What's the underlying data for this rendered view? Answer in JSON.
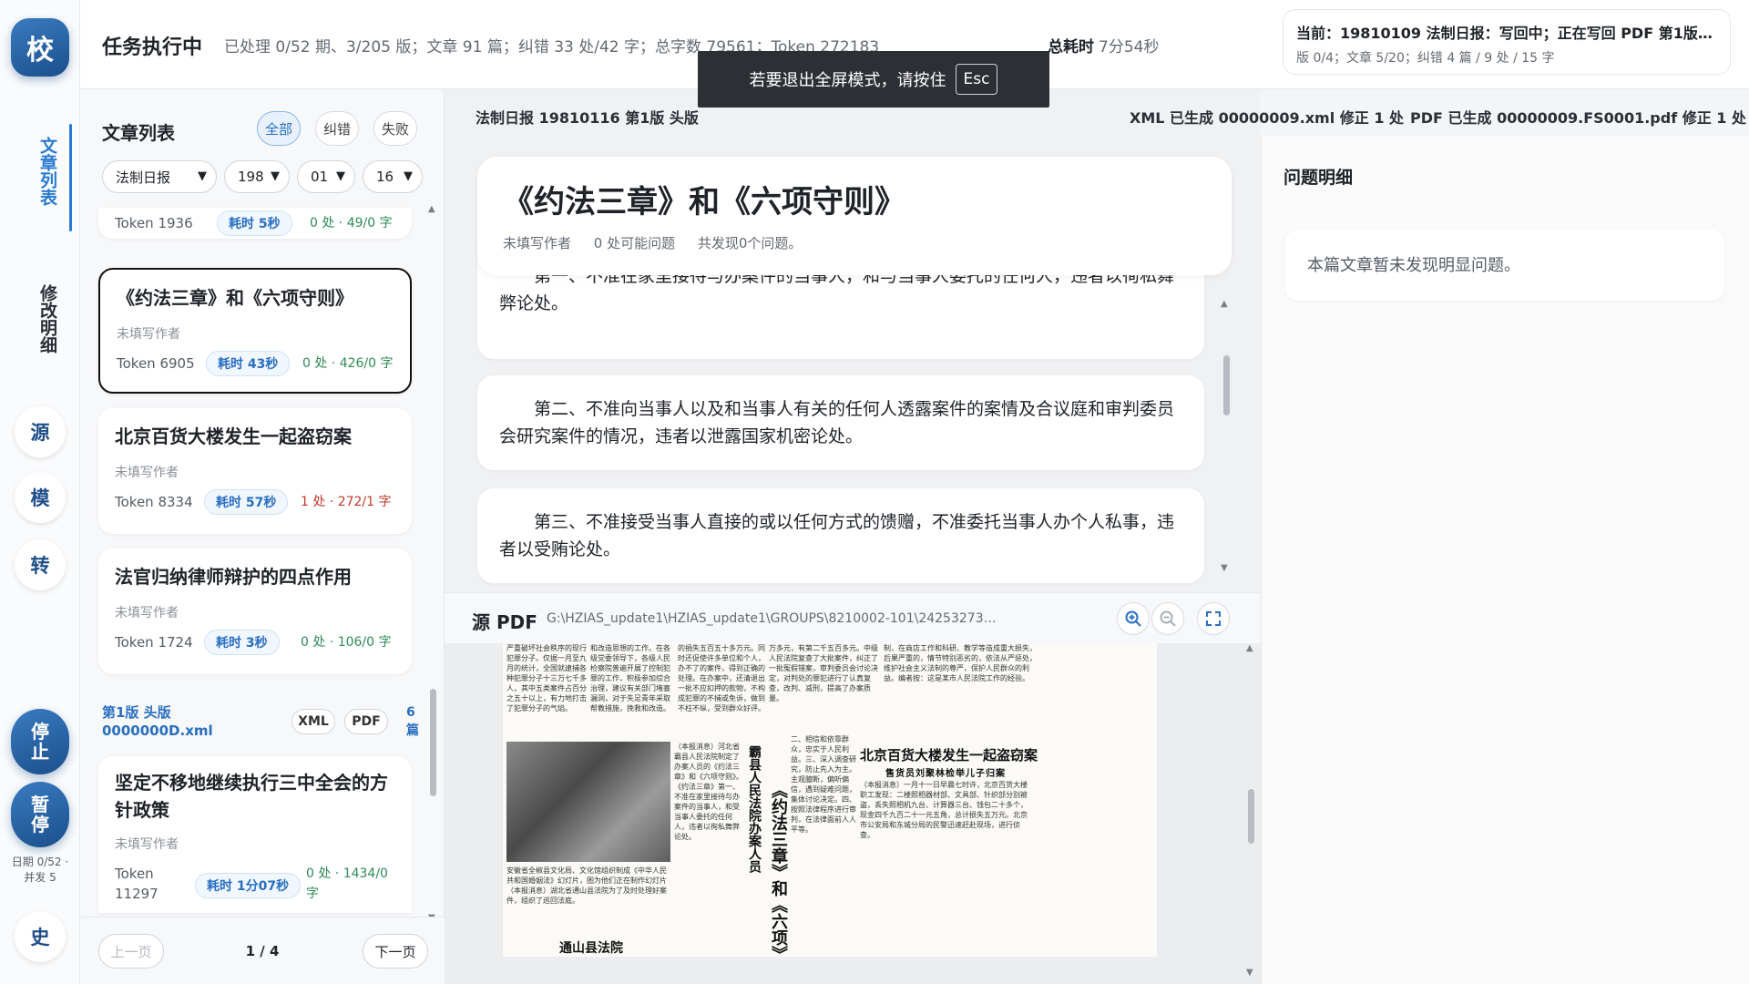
{
  "rail": {
    "logo": "校",
    "tab_articles": "文章列表",
    "tab_changes": "修改明细",
    "btn_source": "源",
    "btn_model": "模",
    "btn_convert": "转",
    "btn_stop": "停止",
    "btn_pause": "暂停",
    "status": "日期 0/52 · 并发 5",
    "btn_history": "史"
  },
  "header": {
    "title": "任务执行中",
    "stats": "已处理 0/52 期、3/205 版；文章 91 篇；纠错 33 处/42 字；总字数 79561；Token 272183",
    "time_label": "总耗时",
    "time_value": "7分54秒",
    "current_title": "当前：19810109 法制日报：写回中；正在写回 PDF 第1版 ...",
    "current_sub": "版 0/4；文章 5/20；纠错 4 篇 / 9 处 / 15 字"
  },
  "toast": {
    "text": "若要退出全屏模式，请按住",
    "key": "Esc"
  },
  "list": {
    "title": "文章列表",
    "filters": [
      "全部",
      "纠错",
      "失败"
    ],
    "selects": {
      "paper": "法制日报",
      "year": "198",
      "month": "01",
      "day": "16"
    },
    "partial_card": {
      "token": "Token 1936",
      "badge": "耗时 5秒",
      "count": "0 处 · 49/0 字"
    },
    "cards": [
      {
        "title": "《约法三章》和《六项守则》",
        "author": "未填写作者",
        "token": "Token 6905",
        "badge": "耗时 43秒",
        "count": "0 处 · 426/0 字"
      },
      {
        "title": "北京百货大楼发生一起盗窃案",
        "author": "未填写作者",
        "token": "Token 8334",
        "badge": "耗时 57秒",
        "count": "1 处 · 272/1 字"
      },
      {
        "title": "法官归纳律师辩护的四点作用",
        "author": "未填写作者",
        "token": "Token 1724",
        "badge": "耗时 3秒",
        "count": "0 处 · 106/0 字"
      },
      {
        "title": "坚定不移地继续执行三中全会的方针政策",
        "author": "未填写作者",
        "token": "Token 11297",
        "badge": "耗时 1分07秒",
        "count": "0 处 · 1434/0 字"
      }
    ],
    "group": {
      "label": "第1版 头版 0000000D.xml",
      "xml": "XML",
      "pdf": "PDF",
      "count": "6 篇"
    },
    "pager": {
      "prev": "上一页",
      "info": "1 / 4",
      "next": "下一页"
    }
  },
  "article": {
    "breadcrumb": "法制日报 19810116  第1版  头版",
    "xml_status": "XML 已生成 00000009.xml 修正 1 处",
    "pdf_status": "PDF 已生成 00000009.FS0001.pdf 修正 1 处",
    "title": "《约法三章》和《六项守则》",
    "author": "未填写作者",
    "issues_possible": "0 处可能问题",
    "issues_found": "共发现0个问题。",
    "paragraphs": [
      "第一、不准在家里接待与办案件的当事人，和与当事人委托的任何人，违者以徇私舞弊论处。",
      "第二、不准向当事人以及和当事人有关的任何人透露案件的案情及合议庭和审判委员会研究案件的情况，违者以泄露国家机密论处。",
      "第三、不准接受当事人直接的或以任何方式的馈赠，不准委托当事人办个人私事，违者以受贿论处。"
    ]
  },
  "pdf": {
    "label": "源 PDF",
    "path": "G:\\HZIAS_update1\\HZIAS_update1\\GROUPS\\8210002-101\\2425327325703889535\\...",
    "headline_main": "北京百货大楼发生一起盗窃案",
    "headline_sub": "售货员刘聚林检举儿子归案",
    "headline_vertical": "《约法三章》和《六项》",
    "headline_court": "霸县人民法院办案人员",
    "headline_tongshan": "通山县法院",
    "columns": [
      "严重破坏社会秩序的现行犯罪分子。仅据一月至九月的统计，全国就逮捕各种犯罪分子十三万七千多人，其中五类案件占百分之五十以上，有力地打击了犯罪分子的气焰。",
      "和改造思想的工作。在各级党委领导下，各级人民检察院普遍开展了控制犯罪的工作，积极参加综合治理，建议有关部门堵塞漏洞，对于失足青年采取帮教措施，挽救和改造。",
      "的捐失五百五十多万元。同时还促使许多单位和个人，办不了的案件，得到正确的处理。在办案中，还清退出一批不应扣押的款物，不构成犯罪的不捕或免诉，做到不枉不纵，受到群众好评。",
      "万多元，有第二千五百多元。中级人民法院复查了大批案件，纠正了一批冤假错案，审判委员会讨论决定，对判处的罪犯进行了认真复查，改判、减刑，提高了办案质量。",
      "制，在商店工作和科研、教学等造成重大损失，后果严重的，情节特别恶劣的，依法从严惩处，维护社会主义法制的尊严，保护人民群众的利益。编者按：这是某市人民法院工作的经验。",
      "（本报消息）河北省霸县人民法院制定了办案人员的《约法三章》和《六项守则》。《约法三章》第一、不准在家里接待与办案件的当事人，和受当事人委托的任何人，违者以徇私舞弊论处。",
      "二、相信和依靠群众，忠实于人民利益。三、深入调查研究，防止先入为主。主观臆断，偏听偏信，遇到疑难问题，集体讨论决定。四、按照法律程序进行审判，在法律面前人人平等。",
      "（本报消息）一月十一日早晨七时许，北京百货大楼职工发现：二楼照相器材部、文具部、针织部分别被盗，丢失照相机九台、计算器三台、钱包二十多个，现金四千九百二十一元五角，总计损失五万元。北京市公安局和东城分局的民警迅速赶赴现场，进行侦查。",
      "安徽省全椒县文化局、文化馆组织制成《中华人民共和国婚姻法》幻灯片，图为他们正在制作幻灯片（本报消息）湖北省通山县法院为了及时处理好案件，组织了巡回法庭。"
    ]
  },
  "issues": {
    "title": "问题明细",
    "empty": "本篇文章暂未发现明显问题。"
  }
}
